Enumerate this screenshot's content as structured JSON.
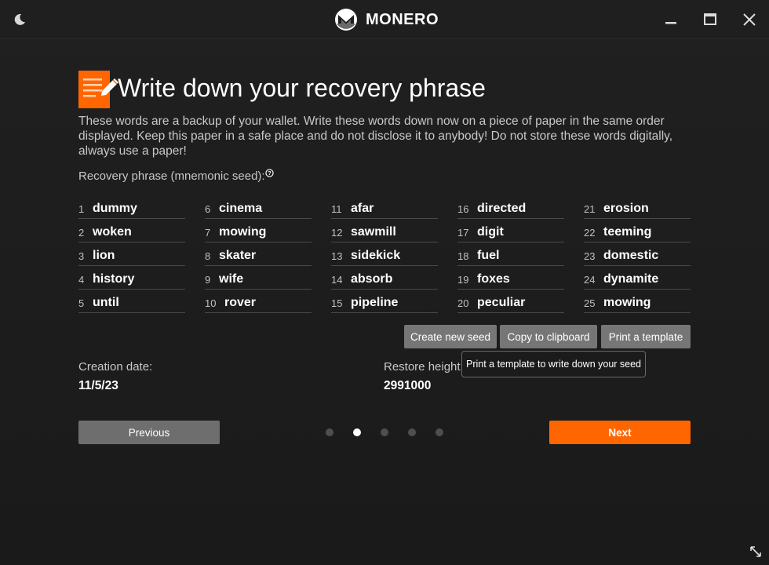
{
  "titlebar": {
    "app_name": "MONERO",
    "theme_icon": "moon-icon",
    "minimize_icon": "minimize-icon",
    "maximize_icon": "maximize-icon",
    "close_icon": "close-icon"
  },
  "header": {
    "title": "Write down your recovery phrase",
    "description": "These words are a backup of your wallet. Write these words down now on a piece of paper in the same order displayed. Keep this paper in a safe place and do not disclose it to anybody! Do not store these words digitally, always use a paper!",
    "seed_label": "Recovery phrase (mnemonic seed):",
    "help_icon": "help-circle-icon"
  },
  "seed": {
    "columns": [
      [
        {
          "num": "1",
          "word": "dummy"
        },
        {
          "num": "2",
          "word": "woken"
        },
        {
          "num": "3",
          "word": "lion"
        },
        {
          "num": "4",
          "word": "history"
        },
        {
          "num": "5",
          "word": "until"
        }
      ],
      [
        {
          "num": "6",
          "word": "cinema"
        },
        {
          "num": "7",
          "word": "mowing"
        },
        {
          "num": "8",
          "word": "skater"
        },
        {
          "num": "9",
          "word": "wife"
        },
        {
          "num": "10",
          "word": "rover"
        }
      ],
      [
        {
          "num": "11",
          "word": "afar"
        },
        {
          "num": "12",
          "word": "sawmill"
        },
        {
          "num": "13",
          "word": "sidekick"
        },
        {
          "num": "14",
          "word": "absorb"
        },
        {
          "num": "15",
          "word": "pipeline"
        }
      ],
      [
        {
          "num": "16",
          "word": "directed"
        },
        {
          "num": "17",
          "word": "digit"
        },
        {
          "num": "18",
          "word": "fuel"
        },
        {
          "num": "19",
          "word": "foxes"
        },
        {
          "num": "20",
          "word": "peculiar"
        }
      ],
      [
        {
          "num": "21",
          "word": "erosion"
        },
        {
          "num": "22",
          "word": "teeming"
        },
        {
          "num": "23",
          "word": "domestic"
        },
        {
          "num": "24",
          "word": "dynamite"
        },
        {
          "num": "25",
          "word": "mowing"
        }
      ]
    ]
  },
  "actions": {
    "create_new_seed": "Create new seed",
    "copy_to_clipboard": "Copy to clipboard",
    "print_template": "Print a template",
    "tooltip": "Print a template to write down your seed"
  },
  "info": {
    "creation_date_label": "Creation date:",
    "creation_date_value": "11/5/23",
    "restore_height_label": "Restore height:",
    "restore_height_value": "2991000"
  },
  "navigation": {
    "previous": "Previous",
    "next": "Next",
    "page_count": 5,
    "active_page": 2
  },
  "colors": {
    "accent": "#ff6600",
    "background": "#1d1d1d",
    "grey_button": "#767676"
  }
}
